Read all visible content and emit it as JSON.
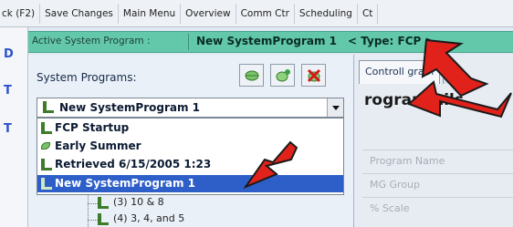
{
  "toolbar": {
    "items": [
      "ck (F2)",
      "Save Changes",
      "Main Menu",
      "Overview",
      "Comm Ctr",
      "Scheduling",
      "Ct"
    ]
  },
  "left_strip": {
    "chars": [
      "D",
      "T",
      "T"
    ]
  },
  "header": {
    "label": "Active System Program :",
    "program_name": "New SystemProgram 1",
    "type_text": "< Type: FCP >"
  },
  "panel": {
    "title": "System Programs:",
    "buttons": [
      {
        "icon": "leaf-icon"
      },
      {
        "icon": "add-program-icon"
      },
      {
        "icon": "delete-icon"
      }
    ],
    "combo_value": "New SystemProgram 1",
    "dropdown": [
      {
        "label": "FCP Startup",
        "icon": "system-program-icon"
      },
      {
        "label": "Early Summer",
        "icon": "leaf-icon"
      },
      {
        "label": "Retrieved 6/15/2005 1:23",
        "icon": "system-program-icon"
      },
      {
        "label": "New SystemProgram 1",
        "icon": "system-program-icon",
        "selected": true
      }
    ],
    "tree": [
      {
        "label": "(3) 10 & 8"
      },
      {
        "label": "(4) 3, 4, and 5"
      }
    ]
  },
  "right": {
    "tabs": [
      "Controll  gram",
      ""
    ],
    "title": "rogram  ails",
    "fields": [
      "Program Name",
      "MG Group",
      "% Scale"
    ]
  },
  "colors": {
    "header_bg": "#62c8a9",
    "selection": "#2e5fc9",
    "arrow": "#e0221b"
  }
}
